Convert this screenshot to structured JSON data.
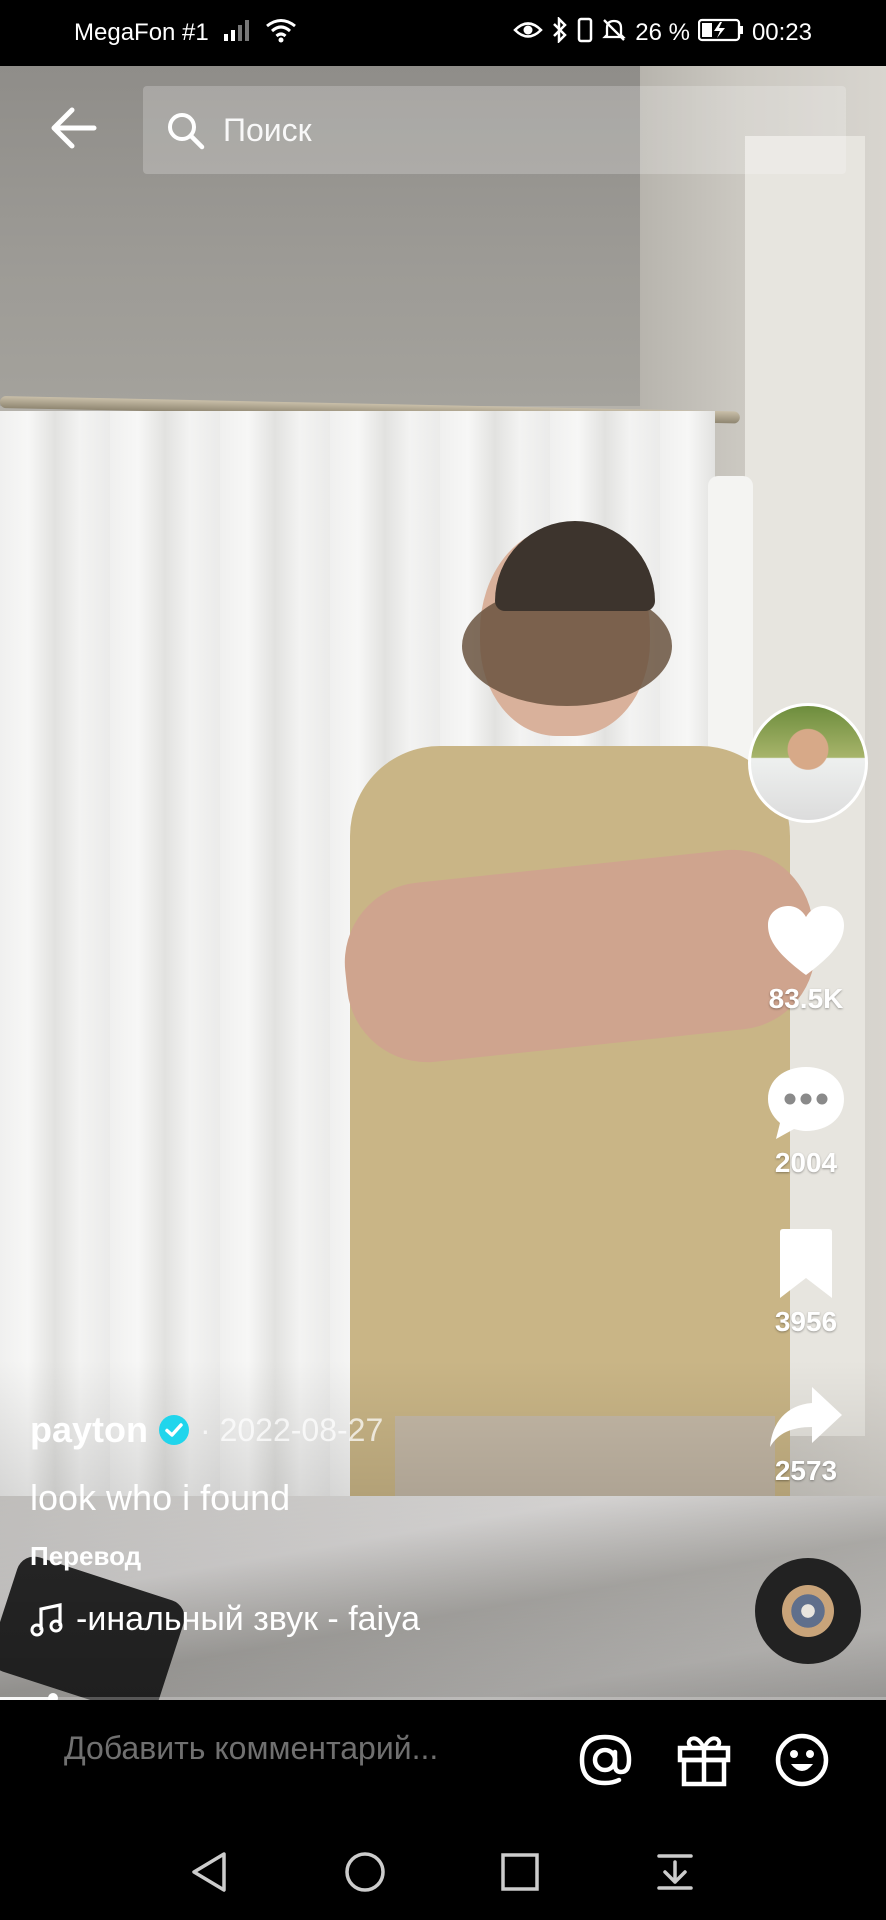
{
  "status_bar": {
    "carrier": "MegaFon #1",
    "battery_percent": "26 %",
    "time": "00:23"
  },
  "search": {
    "placeholder": "Поиск"
  },
  "rail": {
    "likes": "83.5K",
    "comments": "2004",
    "saves": "3956",
    "shares": "2573"
  },
  "post": {
    "author": "payton",
    "date": "· 2022-08-27",
    "caption": "look who i found",
    "translate": "Перевод",
    "music": "-инальный звук - faiya"
  },
  "progress": {
    "fraction": 0.06
  },
  "comment_bar": {
    "placeholder": "Добавить комментарий..."
  },
  "icons": {
    "back": "arrow-left-icon",
    "search": "search-icon",
    "like": "heart-icon",
    "comment": "comment-bubble-icon",
    "save": "bookmark-icon",
    "share": "share-arrow-icon",
    "mention": "at-sign-icon",
    "gift": "gift-icon",
    "emoji": "smiley-icon"
  },
  "colors": {
    "verified": "#20d5ec",
    "background": "#000000"
  }
}
